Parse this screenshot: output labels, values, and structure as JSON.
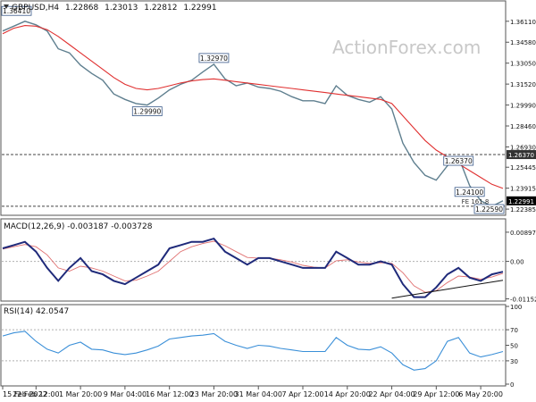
{
  "chart_data": {
    "type": "line",
    "header": {
      "symbol": "GBPUSD,H4",
      "open": "1.22868",
      "high": "1.23013",
      "low": "1.22812",
      "close": "1.22991"
    },
    "watermark": "ActionForex.com",
    "x_ticks": [
      "15 Feb 2022",
      "22 Feb 12:00",
      "1 Mar 20:00",
      "9 Mar 04:00",
      "16 Mar 12:00",
      "23 Mar 20:00",
      "31 Mar 04:00",
      "7 Apr 12:00",
      "14 Apr 20:00",
      "22 Apr 04:00",
      "29 Apr 12:00",
      "6 May 20:00"
    ],
    "price": {
      "ylim": [
        1.2213,
        1.3675
      ],
      "y_ticks": [
        "1.36110",
        "1.34580",
        "1.33050",
        "1.31520",
        "1.29990",
        "1.28460",
        "1.26930",
        "1.25445",
        "1.23915",
        "1.22385"
      ],
      "x": [
        "15 Feb 2022",
        "17 Feb",
        "20 Feb",
        "22 Feb 12:00",
        "24 Feb",
        "25 Feb",
        "27 Feb",
        "1 Mar 20:00",
        "3 Mar",
        "5 Mar",
        "7 Mar",
        "9 Mar 04:00",
        "11 Mar",
        "13 Mar",
        "14 Mar",
        "16 Mar 12:00",
        "18 Mar",
        "20 Mar",
        "22 Mar",
        "23 Mar 20:00",
        "25 Mar",
        "27 Mar",
        "29 Mar",
        "31 Mar 04:00",
        "2 Apr",
        "4 Apr",
        "6 Apr",
        "7 Apr 12:00",
        "9 Apr",
        "11 Apr",
        "13 Apr",
        "14 Apr 20:00",
        "16 Apr",
        "18 Apr",
        "20 Apr",
        "22 Apr 04:00",
        "24 Apr",
        "26 Apr",
        "28 Apr",
        "29 Apr 12:00",
        "1 May",
        "3 May",
        "5 May",
        "6 May 20:00",
        "8 May",
        "9 May"
      ],
      "series": [
        {
          "values": [
            1.354,
            1.3575,
            1.3611,
            1.3585,
            1.354,
            1.341,
            1.338,
            1.329,
            1.323,
            1.318,
            1.308,
            1.304,
            1.301,
            1.2999,
            1.305,
            1.311,
            1.315,
            1.318,
            1.324,
            1.3297,
            1.319,
            1.314,
            1.316,
            1.313,
            1.312,
            1.31,
            1.306,
            1.303,
            1.303,
            1.301,
            1.314,
            1.307,
            1.304,
            1.302,
            1.306,
            1.297,
            1.272,
            1.258,
            1.2485,
            1.245,
            1.2555,
            1.262,
            1.241,
            1.23,
            1.2259,
            1.2299
          ]
        },
        {
          "values": [
            1.352,
            1.356,
            1.358,
            1.3575,
            1.355,
            1.35,
            1.344,
            1.338,
            1.332,
            1.326,
            1.32,
            1.315,
            1.312,
            1.311,
            1.312,
            1.314,
            1.316,
            1.3175,
            1.3185,
            1.319,
            1.318,
            1.317,
            1.316,
            1.315,
            1.314,
            1.313,
            1.312,
            1.311,
            1.31,
            1.309,
            1.308,
            1.307,
            1.306,
            1.305,
            1.304,
            1.301,
            1.292,
            1.283,
            1.274,
            1.267,
            1.262,
            1.257,
            1.252,
            1.247,
            1.242,
            1.239
          ]
        }
      ],
      "level_lines": [
        1.2637,
        1.22599
      ],
      "annotations": [
        {
          "label": "1.36410",
          "x": "15 Feb 2022",
          "y": 1.3641
        },
        {
          "label": "1.32970",
          "x": "23 Mar 20:00",
          "y": 1.3297
        },
        {
          "label": "1.29990",
          "x": "13 Mar",
          "y": 1.2999
        },
        {
          "label": "1.26370",
          "x": "3 May",
          "y": 1.2637
        },
        {
          "label": "1.24100",
          "x": "5 May",
          "y": 1.241
        },
        {
          "label": "1.22590",
          "x": "8 May",
          "y": 1.2259
        }
      ],
      "marker_label": "FE 161.8",
      "price_badges": [
        "1.26370",
        "1.22991"
      ]
    },
    "macd": {
      "label": "MACD(12,26,9) -0.003187 -0.003728",
      "ylim": [
        -0.01165,
        0.0095
      ],
      "y_ticks": [
        "0.00897",
        "0.00",
        "-0.011529"
      ],
      "series": [
        {
          "values": [
            0.004,
            0.005,
            0.006,
            0.003,
            -0.002,
            -0.006,
            -0.002,
            0.001,
            -0.003,
            -0.004,
            -0.006,
            -0.007,
            -0.005,
            -0.003,
            -0.001,
            0.004,
            0.005,
            0.006,
            0.006,
            0.007,
            0.003,
            0.001,
            -0.001,
            0.001,
            0.001,
            0.0,
            -0.001,
            -0.002,
            -0.002,
            -0.002,
            0.003,
            0.001,
            -0.001,
            -0.001,
            0.0,
            -0.001,
            -0.007,
            -0.011,
            -0.011,
            -0.008,
            -0.004,
            -0.002,
            -0.005,
            -0.006,
            -0.004,
            -0.0032
          ]
        },
        {
          "values": [
            0.0038,
            0.0045,
            0.0052,
            0.0045,
            0.002,
            -0.002,
            -0.003,
            -0.0015,
            -0.002,
            -0.003,
            -0.0045,
            -0.006,
            -0.0058,
            -0.0045,
            -0.003,
            0.0,
            0.003,
            0.0045,
            0.0055,
            0.0062,
            0.0048,
            0.003,
            0.0012,
            0.001,
            0.001,
            0.0005,
            -0.0002,
            -0.0012,
            -0.0018,
            -0.002,
            0.0002,
            0.0005,
            -0.0002,
            -0.0006,
            -0.0004,
            -0.0006,
            -0.0035,
            -0.0075,
            -0.0095,
            -0.009,
            -0.0065,
            -0.0045,
            -0.0048,
            -0.0055,
            -0.0048,
            -0.0037
          ]
        }
      ],
      "trendline": [
        [
          -0.0113,
          "22 Apr 04:00"
        ],
        [
          -0.0058,
          "9 May"
        ]
      ]
    },
    "rsi": {
      "label": "RSI(14) 42.0547",
      "ylim": [
        0,
        100
      ],
      "y_ticks": [
        "100",
        "70",
        "50",
        "30",
        "0"
      ],
      "series": [
        {
          "values": [
            62,
            66,
            68,
            55,
            45,
            40,
            50,
            54,
            45,
            44,
            40,
            38,
            40,
            44,
            49,
            58,
            60,
            62,
            63,
            65,
            55,
            50,
            46,
            50,
            49,
            46,
            44,
            42,
            42,
            42,
            60,
            50,
            45,
            44,
            48,
            40,
            25,
            18,
            20,
            30,
            55,
            60,
            40,
            35,
            38,
            42
          ]
        }
      ]
    }
  }
}
